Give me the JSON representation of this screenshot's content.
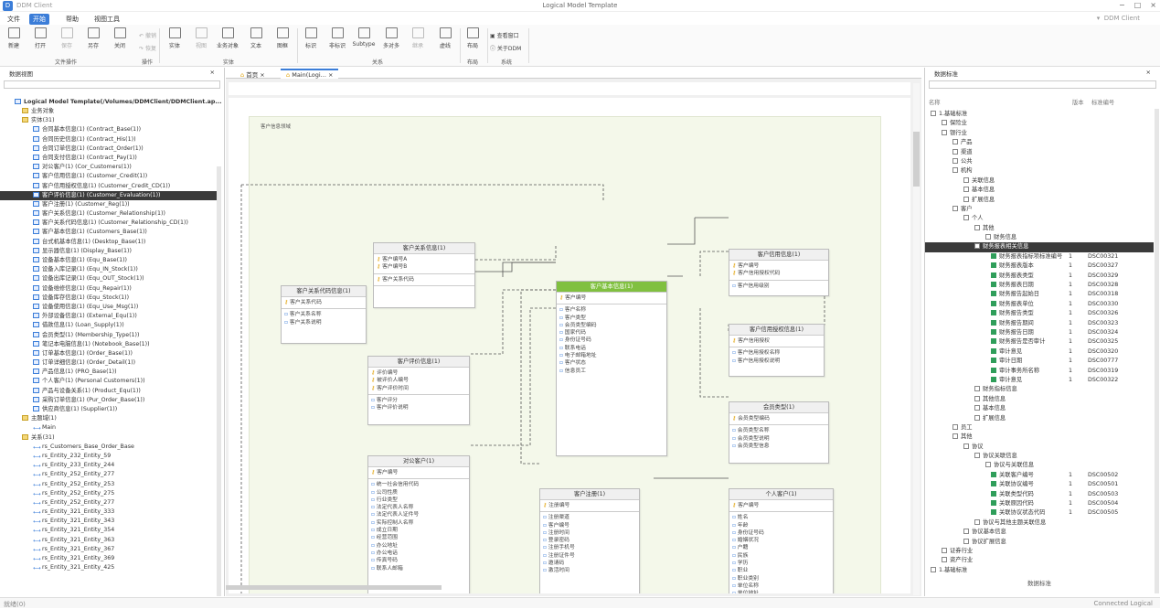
{
  "titlebar": {
    "app": "DDM Client",
    "window_title": "Logical Model Template"
  },
  "menu": {
    "items": [
      "文件",
      "开始",
      "帮助",
      "视图工具"
    ],
    "user": "DDM Client"
  },
  "ribbon": {
    "buttons": [
      "新建",
      "打开",
      "保存",
      "另存",
      "关闭",
      "实体",
      "视图",
      "业务对象",
      "文本",
      "图框",
      "标识",
      "非标识",
      "Subtype",
      "多对多",
      "继承",
      "虚线",
      "布局"
    ],
    "small": [
      "撤销",
      "恢复"
    ],
    "right": [
      "查看窗口",
      "关于DDM"
    ],
    "groups": [
      "文件操作",
      "操作",
      "实体",
      "关系",
      "布局",
      "系统"
    ]
  },
  "left": {
    "title": "数据视图",
    "root": "Logical Model Template(/Volumes/DDMClient/DDMClient.ap...",
    "items": [
      "业务对象",
      "实体(31)",
      "合同基本信息(1) (Contract_Base(1))",
      "合同历史信息(1) (Contract_His(1))",
      "合同订单信息(1) (Contract_Order(1))",
      "合同支付信息(1) (Contract_Pay(1))",
      "对公客户(1) (Cor_Customers(1))",
      "客户信用信息(1) (Customer_Credit(1))",
      "客户信用授权信息(1) (Customer_Credit_CD(1))",
      "客户评价信息(1) (Customer_Evaluation(1))",
      "客户注册(1) (Customer_Reg(1))",
      "客户关系信息(1) (Customer_Relationship(1))",
      "客户关系代码信息(1) (Customer_Relationship_CD(1))",
      "客户基本信息(1) (Customers_Base(1))",
      "台式机基本信息(1) (Desktop_Base(1))",
      "显示器信息(1) (Display_Base(1))",
      "设备基本信息(1) (Equ_Base(1))",
      "设备入库记录(1) (Equ_IN_Stock(1))",
      "设备出库记录(1) (Equ_OUT_Stock(1))",
      "设备维修信息(1) (Equ_Repair(1))",
      "设备库存信息(1) (Equ_Stock(1))",
      "设备使用信息(1) (Equ_Use_Msg(1))",
      "外部设备信息(1) (External_Equ(1))",
      "借款信息(1) (Loan_Supply(1))",
      "会员类型(1) (Membership_Type(1))",
      "笔记本电脑信息(1) (Notebook_Base(1))",
      "订单基本信息(1) (Order_Base(1))",
      "订单详细信息(1) (Order_Detail(1))",
      "产品信息(1) (PRO_Base(1))",
      "个人客户(1) (Personal Customers(1))",
      "产品与设备关系(1) (Product_Equ(1))",
      "采购订单信息(1) (Pur_Order_Base(1))",
      "供应商信息(1) (Supplier(1))",
      "主题域(1)",
      "Main",
      "关系(31)",
      "rs_Customers_Base_Order_Base",
      "rs_Entity_232_Entity_59",
      "rs_Entity_233_Entity_244",
      "rs_Entity_252_Entity_277",
      "rs_Entity_252_Entity_253",
      "rs_Entity_252_Entity_275",
      "rs_Entity_252_Entity_277",
      "rs_Entity_321_Entity_333",
      "rs_Entity_321_Entity_343",
      "rs_Entity_321_Entity_354",
      "rs_Entity_321_Entity_363",
      "rs_Entity_321_Entity_367",
      "rs_Entity_321_Entity_369",
      "rs_Entity_321_Entity_425"
    ]
  },
  "tabs": [
    "首页",
    "Main(Logi..."
  ],
  "canvas": {
    "area_label": "客户信息领域",
    "entities": [
      {
        "title": "客户关系信息(1)",
        "pk": [
          "客户编号A",
          "客户编号B"
        ],
        "fk": [
          "客户关系代码"
        ],
        "attrs": []
      },
      {
        "title": "客户关系代码信息(1)",
        "pk": [
          "客户关系代码"
        ],
        "fk": [],
        "attrs": [
          "客户关系名称",
          "客户关系说明"
        ]
      },
      {
        "title": "客户基本信息(1)",
        "pk": [
          "客户编号"
        ],
        "fk": [],
        "attrs": [
          "客户名称",
          "客户类型",
          "会员类型编码",
          "国家代码",
          "身份证号码",
          "联系电话",
          "电子邮箱地址",
          "客户状态",
          "信息员工"
        ]
      },
      {
        "title": "客户信用信息(1)",
        "pk": [
          "客户编号",
          "客户信用授权代码"
        ],
        "fk": [],
        "attrs": [
          "客户信用级别"
        ]
      },
      {
        "title": "客户信用授权信息(1)",
        "pk": [
          "客户信用授权"
        ],
        "fk": [],
        "attrs": [
          "客户信用授权名称",
          "客户信用授权说明"
        ]
      },
      {
        "title": "客户评价信息(1)",
        "pk": [
          "评价编号",
          "被评价人编号",
          "客户评价时间"
        ],
        "fk": [],
        "attrs": [
          "客户评分",
          "客户评价说明"
        ]
      },
      {
        "title": "会员类型(1)",
        "pk": [
          "会员类型编码"
        ],
        "fk": [],
        "attrs": [
          "会员类型名称",
          "会员类型说明",
          "会员类型信息"
        ]
      },
      {
        "title": "对公客户(1)",
        "pk": [
          "客户编号"
        ],
        "fk": [],
        "attrs": [
          "统一社会信用代码",
          "公司性质",
          "行业类型",
          "法定代表人名称",
          "法定代表人证件号",
          "实际控制人名称",
          "成立日期",
          "经营范围",
          "办公地址",
          "办公电话",
          "传真号码",
          "联系人邮箱"
        ]
      },
      {
        "title": "客户注册(1)",
        "pk": [
          "注册编号"
        ],
        "fk": [],
        "attrs": [
          "注册渠道",
          "客户编号",
          "注册时间",
          "登录密码",
          "注册手机号",
          "注册证件号",
          "邀请码",
          "激活时间"
        ]
      },
      {
        "title": "个人客户(1)",
        "pk": [
          "客户编号"
        ],
        "fk": [],
        "attrs": [
          "姓名",
          "年龄",
          "身份证号码",
          "婚姻状况",
          "户籍",
          "民族",
          "学历",
          "职业",
          "职业类别",
          "单位名称",
          "单位地址"
        ]
      }
    ]
  },
  "right": {
    "title": "数据标准",
    "columns": [
      "名称",
      "版本",
      "标准编号"
    ],
    "rows": [
      [
        "1.基础标准",
        "",
        ""
      ],
      [
        "保险业",
        "",
        ""
      ],
      [
        "银行业",
        "",
        ""
      ],
      [
        "产品",
        "",
        ""
      ],
      [
        "渠道",
        "",
        ""
      ],
      [
        "公共",
        "",
        ""
      ],
      [
        "机构",
        "",
        ""
      ],
      [
        "关联信息",
        "",
        ""
      ],
      [
        "基本信息",
        "",
        ""
      ],
      [
        "扩展信息",
        "",
        ""
      ],
      [
        "客户",
        "",
        ""
      ],
      [
        "个人",
        "",
        ""
      ],
      [
        "其他",
        "",
        ""
      ],
      [
        "财务信息",
        "",
        ""
      ],
      [
        "财务报表相关信息",
        "",
        ""
      ],
      [
        "财务报表指标项标准编号",
        "1",
        "DSC00321"
      ],
      [
        "财务报表版本",
        "1",
        "DSC00327"
      ],
      [
        "财务报表类型",
        "1",
        "DSC00329"
      ],
      [
        "财务报表日期",
        "1",
        "DSC00328"
      ],
      [
        "财务报告起始日",
        "1",
        "DSC00318"
      ],
      [
        "财务报表单位",
        "1",
        "DSC00330"
      ],
      [
        "财务报告类型",
        "1",
        "DSC00326"
      ],
      [
        "财务报告期间",
        "1",
        "DSC00323"
      ],
      [
        "财务报告日期",
        "1",
        "DSC00324"
      ],
      [
        "财务报告是否审计",
        "1",
        "DSC00325"
      ],
      [
        "审计意见",
        "1",
        "DSC00320"
      ],
      [
        "审计日期",
        "1",
        "DSC00777"
      ],
      [
        "审计事务所名称",
        "1",
        "DSC00319"
      ],
      [
        "审计意见",
        "1",
        "DSC00322"
      ],
      [
        "财务指标信息",
        "",
        ""
      ],
      [
        "其他信息",
        "",
        ""
      ],
      [
        "基本信息",
        "",
        ""
      ],
      [
        "扩展信息",
        "",
        ""
      ],
      [
        "员工",
        "",
        ""
      ],
      [
        "其他",
        "",
        ""
      ],
      [
        "协议",
        "",
        ""
      ],
      [
        "协议关联信息",
        "",
        ""
      ],
      [
        "协议与关联信息",
        "",
        ""
      ],
      [
        "关联客户编号",
        "1",
        "DSC00502"
      ],
      [
        "关联协议编号",
        "1",
        "DSC00501"
      ],
      [
        "关联类型代码",
        "1",
        "DSC00503"
      ],
      [
        "关联原因代码",
        "1",
        "DSC00504"
      ],
      [
        "关联协议状态代码",
        "1",
        "DSC00505"
      ],
      [
        "协议与其他主题关联信息",
        "",
        ""
      ],
      [
        "协议基本信息",
        "",
        ""
      ],
      [
        "协议扩展信息",
        "",
        ""
      ],
      [
        "证券行业",
        "",
        ""
      ],
      [
        "资产行业",
        "",
        ""
      ],
      [
        "1.基础标准",
        "",
        ""
      ]
    ],
    "footer": "数据标准"
  },
  "status": {
    "left": "就绪(0)",
    "right": "Connected  Logical"
  }
}
